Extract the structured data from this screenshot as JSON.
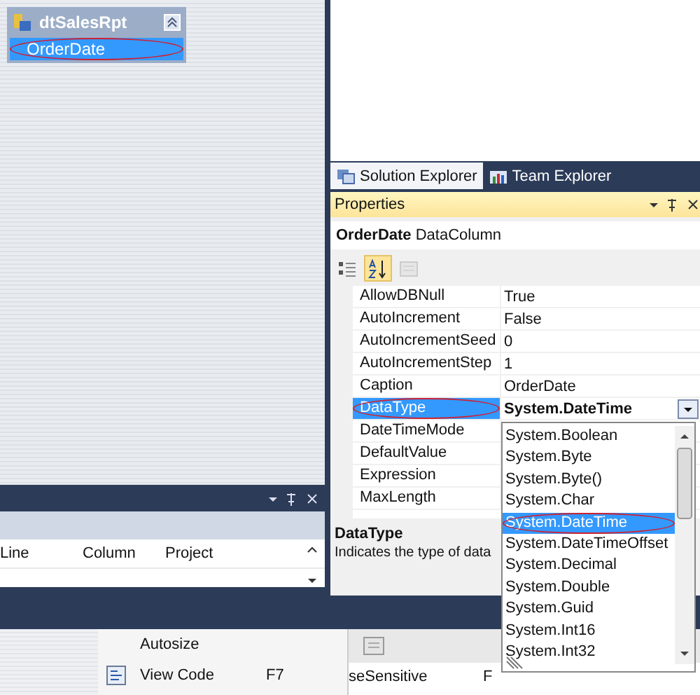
{
  "designer": {
    "table": {
      "title": "dtSalesRpt",
      "columns": [
        {
          "name": "OrderDate",
          "selected": true,
          "circled": true
        }
      ]
    }
  },
  "error_list": {
    "columns": [
      "Line",
      "Column",
      "Project"
    ]
  },
  "context_menu": {
    "items": [
      {
        "label": "Autosize",
        "has_icon": false
      },
      {
        "label": "View Code",
        "shortcut": "F7",
        "has_icon": true
      }
    ]
  },
  "background_grid": {
    "cells": [
      "seSensitive",
      "F"
    ]
  },
  "explorer_tabs": [
    {
      "label": "Solution Explorer",
      "selected": true
    },
    {
      "label": "Team Explorer",
      "selected": false
    }
  ],
  "properties": {
    "title": "Properties",
    "object_name": "OrderDate",
    "object_type": "DataColumn",
    "toolbar": [
      {
        "kind": "categorized",
        "selected": false,
        "disabled": false
      },
      {
        "kind": "alphabetical",
        "selected": true,
        "disabled": false
      },
      {
        "kind": "pages",
        "selected": false,
        "disabled": true
      }
    ],
    "rows": [
      {
        "name": "AllowDBNull",
        "value": "True",
        "selected": false,
        "circled": false
      },
      {
        "name": "AutoIncrement",
        "value": "False",
        "selected": false,
        "circled": false
      },
      {
        "name": "AutoIncrementSeed",
        "value": "0",
        "selected": false,
        "circled": false
      },
      {
        "name": "AutoIncrementStep",
        "value": "1",
        "selected": false,
        "circled": false
      },
      {
        "name": "Caption",
        "value": "OrderDate",
        "selected": false,
        "circled": false
      },
      {
        "name": "DataType",
        "value": "System.DateTime",
        "selected": true,
        "circled": true
      },
      {
        "name": "DateTimeMode",
        "selected": false,
        "circled": false
      },
      {
        "name": "DefaultValue",
        "selected": false,
        "circled": false
      },
      {
        "name": "Expression",
        "selected": false,
        "circled": false
      },
      {
        "name": "MaxLength",
        "selected": false,
        "circled": false
      }
    ],
    "description": {
      "title": "DataType",
      "text": "Indicates the type of data"
    }
  },
  "dropdown": {
    "items": [
      {
        "label": "System.Boolean",
        "selected": false,
        "circled": false
      },
      {
        "label": "System.Byte",
        "selected": false,
        "circled": false
      },
      {
        "label": "System.Byte()",
        "selected": false,
        "circled": false
      },
      {
        "label": "System.Char",
        "selected": false,
        "circled": false
      },
      {
        "label": "System.DateTime",
        "selected": true,
        "circled": true
      },
      {
        "label": "System.DateTimeOffset",
        "selected": false,
        "circled": false
      },
      {
        "label": "System.Decimal",
        "selected": false,
        "circled": false
      },
      {
        "label": "System.Double",
        "selected": false,
        "circled": false
      },
      {
        "label": "System.Guid",
        "selected": false,
        "circled": false
      },
      {
        "label": "System.Int16",
        "selected": false,
        "circled": false
      },
      {
        "label": "System.Int32",
        "selected": false,
        "circled": false
      }
    ]
  }
}
